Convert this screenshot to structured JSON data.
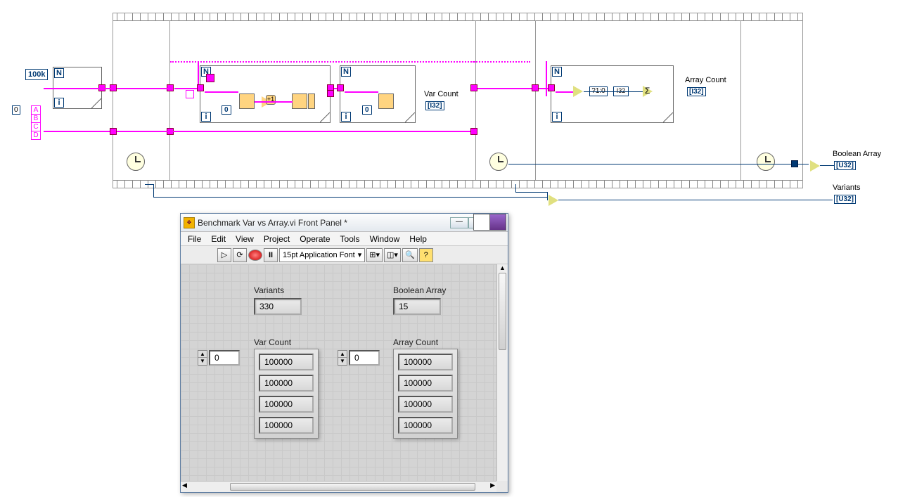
{
  "diagram": {
    "const_100k": "100k",
    "const_index": "0",
    "enum": {
      "a": "A",
      "b": "B",
      "c": "C",
      "d": "D"
    },
    "inner": {
      "zero1": "0",
      "zero2": "0"
    },
    "range_label": "?1:0",
    "i32": "I32",
    "var_count_label": "Var Count",
    "array_count_label": "Array Count",
    "boolean_array_label": "Boolean Array",
    "variants_label": "Variants",
    "ind_type": "[I32]",
    "u32": "[U32]"
  },
  "window": {
    "title": "Benchmark Var vs Array.vi Front Panel *",
    "menu": {
      "file": "File",
      "edit": "Edit",
      "view": "View",
      "project": "Project",
      "operate": "Operate",
      "tools": "Tools",
      "window": "Window",
      "help": "Help"
    },
    "font": "15pt Application Font",
    "variants": {
      "label": "Variants",
      "value": "330"
    },
    "boolean_array": {
      "label": "Boolean Array",
      "value": "15"
    },
    "var_count": {
      "label": "Var Count",
      "index": "0",
      "cells": [
        "100000",
        "100000",
        "100000",
        "100000"
      ]
    },
    "array_count": {
      "label": "Array Count",
      "index": "0",
      "cells": [
        "100000",
        "100000",
        "100000",
        "100000"
      ]
    }
  }
}
